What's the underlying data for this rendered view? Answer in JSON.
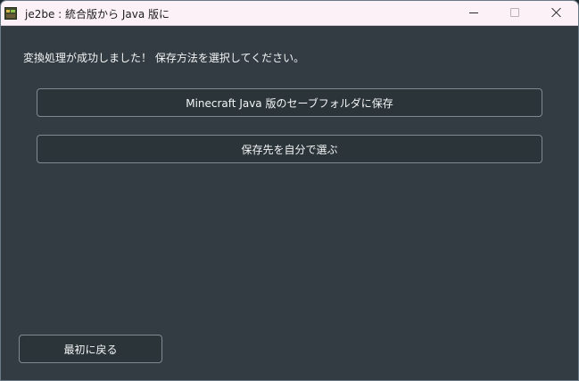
{
  "window": {
    "title": "je2be : 統合版から Java 版に",
    "icon": "grass-block-app-icon",
    "controls": [
      "minimize",
      "maximize",
      "close"
    ]
  },
  "main": {
    "message": "変換処理が成功しました！ 保存方法を選択してください。",
    "buttons": {
      "save_java": "Minecraft Java 版のセーブフォルダに保存",
      "choose_destination": "保存先を自分で選ぶ",
      "back_to_start": "最初に戻る"
    }
  },
  "colors": {
    "titlebar_bg": "#fbf1f7",
    "window_bg": "#333c42",
    "button_bg": "#2b3439",
    "button_border": "#7f8a91",
    "text": "#f2f4f5"
  }
}
